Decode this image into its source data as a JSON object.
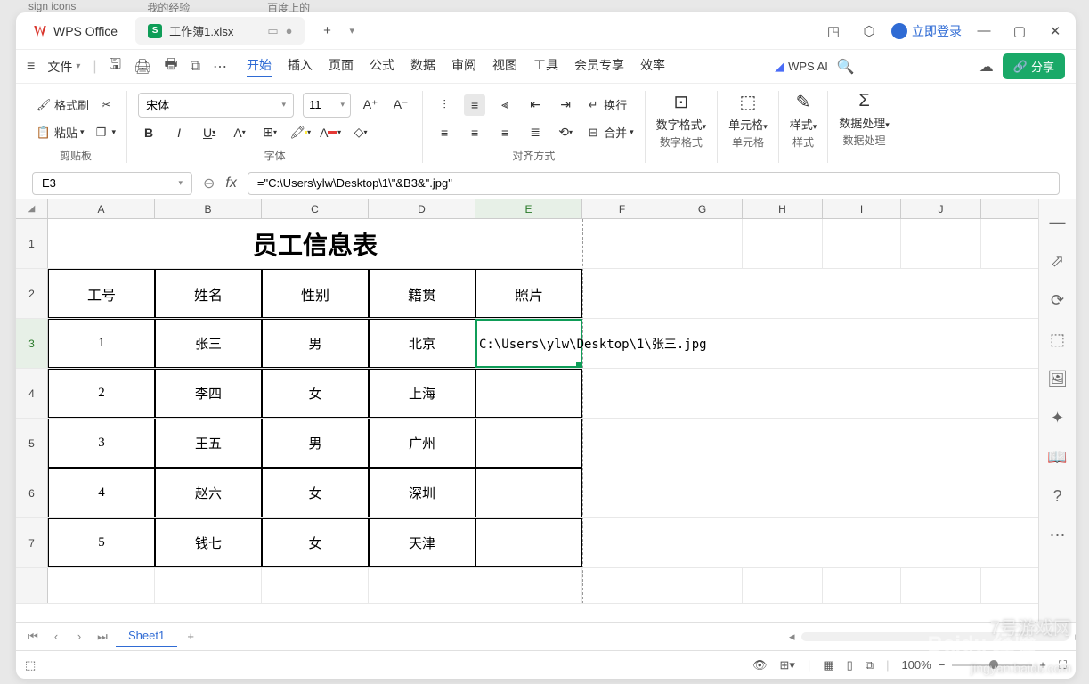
{
  "browsertabs": [
    "sign icons",
    "我的经验_",
    "百度上的"
  ],
  "app": {
    "name": "WPS Office",
    "filename": "工作簿1.xlsx",
    "login": "立即登录"
  },
  "menu": {
    "file": "文件",
    "tabs": [
      "开始",
      "插入",
      "页面",
      "公式",
      "数据",
      "审阅",
      "视图",
      "工具",
      "会员专享",
      "效率"
    ],
    "wpsai": "WPS AI",
    "share": "分享"
  },
  "ribbon": {
    "fmtbrush": "格式刷",
    "paste": "粘贴",
    "fontname": "宋体",
    "fontsize": "11",
    "wrap": "换行",
    "merge": "合并",
    "numfmt": "数字格式",
    "cellfmt": "单元格",
    "styles": "样式",
    "dataproc": "数据处理",
    "g1": "剪贴板",
    "g2": "字体",
    "g3": "对齐方式",
    "g4": "数字格式",
    "g5": "单元格",
    "g6": "样式",
    "g7": "数据处理"
  },
  "formula": {
    "cell": "E3",
    "fx": "fx",
    "value": "=\"C:\\Users\\ylw\\Desktop\\1\\\"&B3&\".jpg\""
  },
  "cols": [
    "A",
    "B",
    "C",
    "D",
    "E",
    "F",
    "G",
    "H",
    "I",
    "J"
  ],
  "rows": [
    "1",
    "2",
    "3",
    "4",
    "5",
    "6",
    "7"
  ],
  "sheet": {
    "title": "员工信息表",
    "headers": [
      "工号",
      "姓名",
      "性别",
      "籍贯",
      "照片"
    ],
    "data": [
      [
        "1",
        "张三",
        "男",
        "北京",
        "C:\\Users\\ylw\\Desktop\\1\\张三.jpg"
      ],
      [
        "2",
        "李四",
        "女",
        "上海",
        ""
      ],
      [
        "3",
        "王五",
        "男",
        "广州",
        ""
      ],
      [
        "4",
        "赵六",
        "女",
        "深圳",
        ""
      ],
      [
        "5",
        "钱七",
        "女",
        "天津",
        ""
      ]
    ]
  },
  "tab": "Sheet1",
  "zoom": "100%",
  "watermarks": {
    "baidu": "Baidu 经验",
    "url": "jingyan.baidu.com",
    "game": "7号游戏网"
  }
}
